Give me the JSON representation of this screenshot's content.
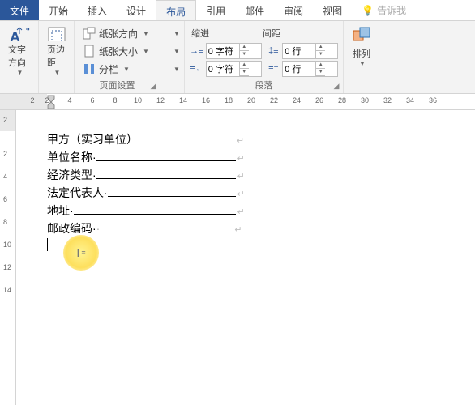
{
  "tabs": {
    "file": "文件",
    "home": "开始",
    "insert": "插入",
    "design": "设计",
    "layout": "布局",
    "references": "引用",
    "mailings": "邮件",
    "review": "审阅",
    "view": "视图",
    "tellme": "告诉我"
  },
  "ribbon": {
    "textdir": "文字方向",
    "margins": "页边距",
    "orientation": "纸张方向",
    "size": "纸张大小",
    "columns": "分栏",
    "pageSetup": "页面设置",
    "indent": "缩进",
    "spacing": "间距",
    "leftIndent": "0 字符",
    "rightIndent": "0 字符",
    "before": "0 行",
    "after": "0 行",
    "paragraph": "段落",
    "arrange": "排列"
  },
  "ruler": {
    "h": [
      "2",
      "2",
      "4",
      "6",
      "8",
      "10",
      "12",
      "14",
      "16",
      "18",
      "20",
      "22",
      "24",
      "26",
      "28",
      "30",
      "32",
      "34",
      "36"
    ],
    "v": [
      "2",
      "2",
      "4",
      "6",
      "8",
      "10",
      "12",
      "14"
    ]
  },
  "doc": {
    "l1a": "甲方（实习单位）",
    "l1b": "",
    "l2a": "单位名称",
    "l2b": "",
    "l3a": "经济类型",
    "l3b": "",
    "l4a": "法定代表人",
    "l4b": "",
    "l5a": "地址",
    "l5b": "",
    "l6a": "邮政编码",
    "l6b": ""
  }
}
